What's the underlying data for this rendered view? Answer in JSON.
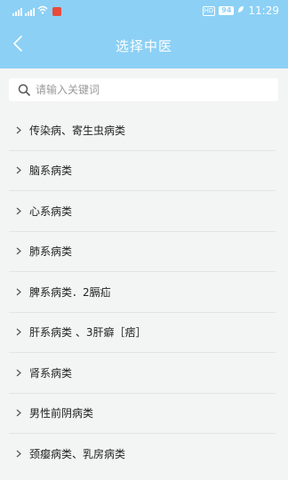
{
  "statusbar": {
    "carrier_left": "4G",
    "network_hd": "HD",
    "battery": "94",
    "time": "11:29"
  },
  "navbar": {
    "title": "选择中医",
    "back_icon": "chevron-left-icon"
  },
  "search": {
    "placeholder": "请输入关键词",
    "value": "",
    "icon": "search-icon"
  },
  "categories": [
    {
      "label": "传染病、寄生虫病类"
    },
    {
      "label": "脑系病类"
    },
    {
      "label": "心系病类"
    },
    {
      "label": "肺系病类"
    },
    {
      "label": "脾系病类．2膈疝"
    },
    {
      "label": "肝系病类 、3肝癖［痞］"
    },
    {
      "label": "肾系病类"
    },
    {
      "label": "男性前阴病类"
    },
    {
      "label": "颈瘿病类、乳房病类"
    }
  ],
  "colors": {
    "header": "#8cd0f5",
    "background": "#f3f4f4",
    "divider": "#e3e3e3"
  }
}
